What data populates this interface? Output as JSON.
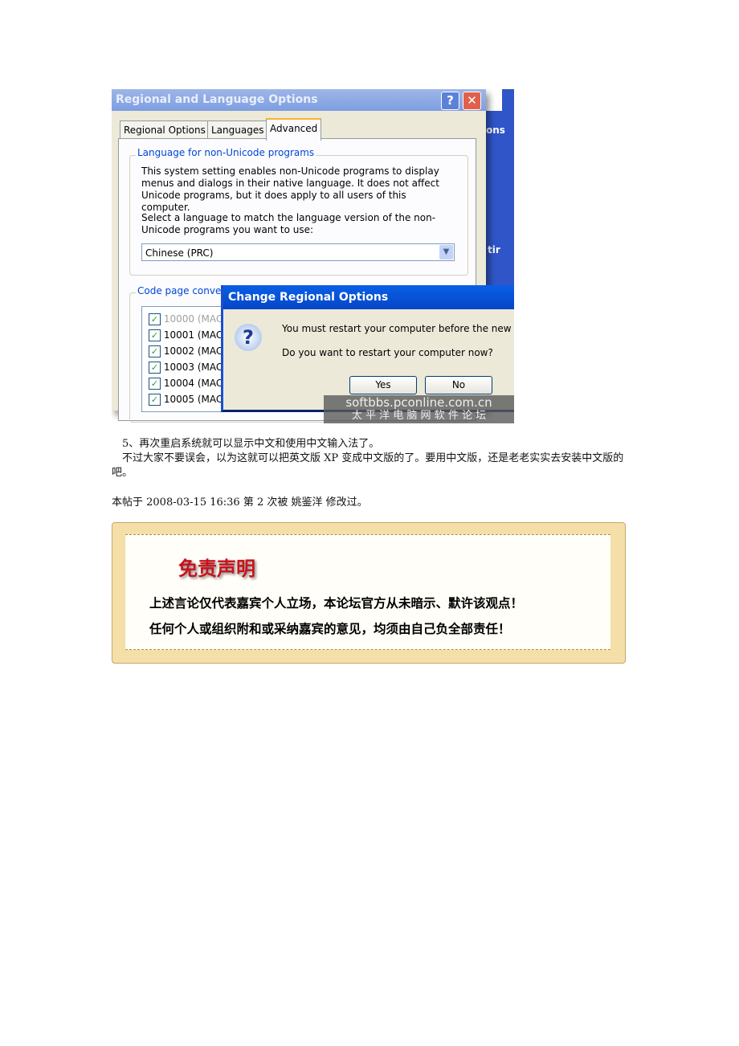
{
  "screenshot": {
    "window_title": "Regional and Language Options",
    "tabs": [
      "Regional Options",
      "Languages",
      "Advanced"
    ],
    "active_tab": "Advanced",
    "group1_label": "Language for non-Unicode programs",
    "group1_text1": "This system setting enables non-Unicode programs to display menus and dialogs in their native language. It does not affect Unicode programs, but it does apply to all users of this computer.",
    "group1_text2": "Select a language to match the language version of the non-Unicode programs you want to use:",
    "language_select": "Chinese (PRC)",
    "group2_label": "Code page conver",
    "code_pages": [
      "10000 (MAC",
      "10001 (MAC",
      "10002 (MAC",
      "10003 (MAC",
      "10004 (MAC",
      "10005 (MAC"
    ],
    "bg_text1": "ons",
    "bg_text2": "tir",
    "dialog": {
      "title": "Change Regional Options",
      "line1": "You must restart your computer before the new s",
      "line2": "Do you want to restart your computer now?",
      "yes": "Yes",
      "no": "No"
    },
    "watermark_line1": "softbbs.pconline.com.cn",
    "watermark_line2": "太 平 洋 电 脑 网 软 件 论 坛"
  },
  "body": {
    "para1": "5、再次重启系统就可以显示中文和使用中文输入法了。",
    "para2": "不过大家不要误会，以为这就可以把英文版 XP 变成中文版的了。要用中文版，还是老老实实去安装中文版的吧。",
    "edit_prefix": "本帖于 2008-03-15 16:36 第 2 次被",
    "edit_user": "姚鉴洋",
    "edit_suffix": "修改过。"
  },
  "disclaimer": {
    "title": "免责声明",
    "line1": "上述言论仅代表嘉宾个人立场，本论坛官方从未暗示、默许该观点！",
    "line2": "任何个人或组织附和或采纳嘉宾的意见，均须由自己负全部责任！"
  }
}
